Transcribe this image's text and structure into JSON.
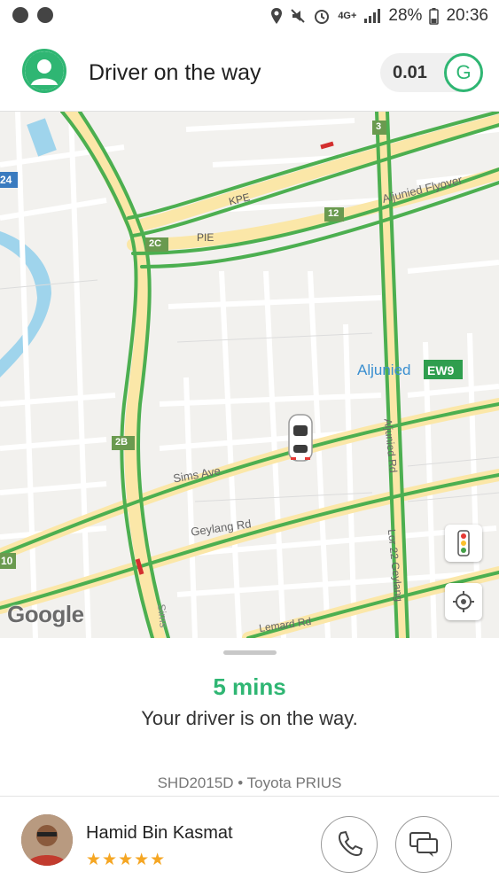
{
  "status_bar": {
    "network": "4G+",
    "battery": "28%",
    "time": "20:36"
  },
  "header": {
    "title": "Driver on the way",
    "credits": "0.01",
    "credits_icon_letter": "G"
  },
  "map": {
    "labels": {
      "kpe": "KPE",
      "pie": "PIE",
      "flyover": "Aljunied Flyover",
      "sims_ave": "Sims Ave",
      "geylang_rd": "Geylang Rd",
      "aljunied_rd": "Aljunied Rd",
      "lor22": "Lor 22 Geylang",
      "sims_way": "Sims",
      "lemard_rd": "Lemard Rd",
      "station": "Aljunied",
      "station_code": "EW9",
      "exit_3": "3",
      "exit_12": "12",
      "exit_2c": "2C",
      "exit_2b": "2B",
      "exit_24": "24",
      "exit_10": "10"
    },
    "attribution": "Google",
    "colors": {
      "traffic_green": "#4caf50",
      "traffic_red": "#d32f2f",
      "road_yellow": "#fbe7a8",
      "water": "#9fd4ec",
      "brand_green": "#2fb673"
    }
  },
  "trip": {
    "eta": "5 mins",
    "status": "Your driver is on the way.",
    "vehicle": "SHD2015D • Toyota PRIUS"
  },
  "driver": {
    "name": "Hamid Bin Kasmat",
    "rating_stars": "★★★★★",
    "rating": 4.5
  },
  "icons": {
    "header_avatar": "user-avatar-icon",
    "credits": "grab-credits-icon",
    "traffic": "traffic-light-icon",
    "locate": "locate-me-icon",
    "call": "phone-icon",
    "chat": "chat-icon"
  }
}
